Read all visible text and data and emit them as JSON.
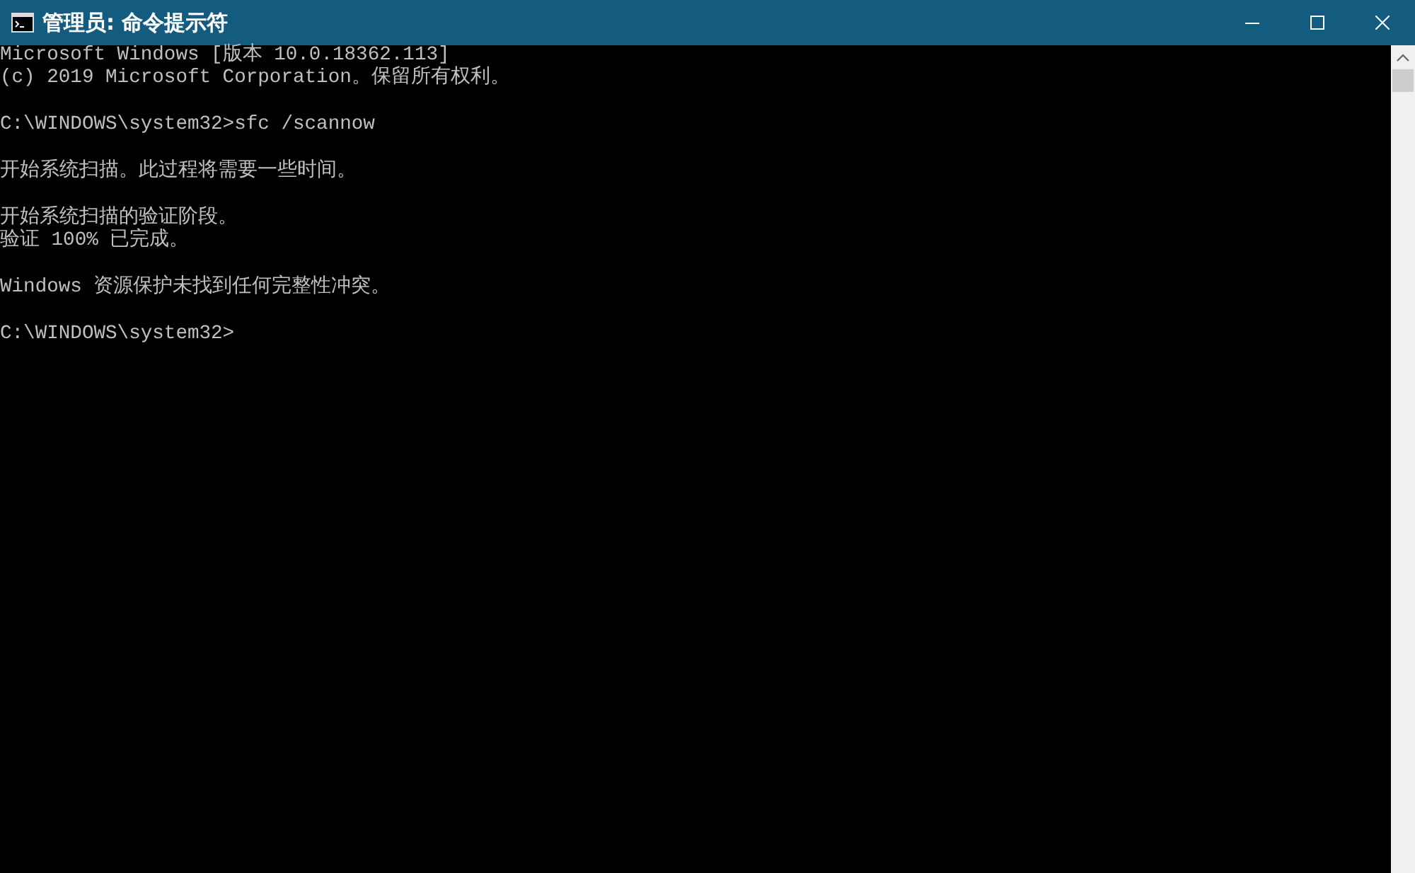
{
  "window": {
    "title": "管理员: 命令提示符"
  },
  "console": {
    "blocks": [
      [
        "Microsoft Windows [版本 10.0.18362.113]",
        "(c) 2019 Microsoft Corporation。保留所有权利。"
      ],
      [
        "C:\\WINDOWS\\system32>sfc /scannow"
      ],
      [
        "开始系统扫描。此过程将需要一些时间。"
      ],
      [
        "开始系统扫描的验证阶段。",
        "验证 100% 已完成。"
      ],
      [
        "Windows 资源保护未找到任何完整性冲突。"
      ],
      [
        "C:\\WINDOWS\\system32>"
      ]
    ]
  }
}
